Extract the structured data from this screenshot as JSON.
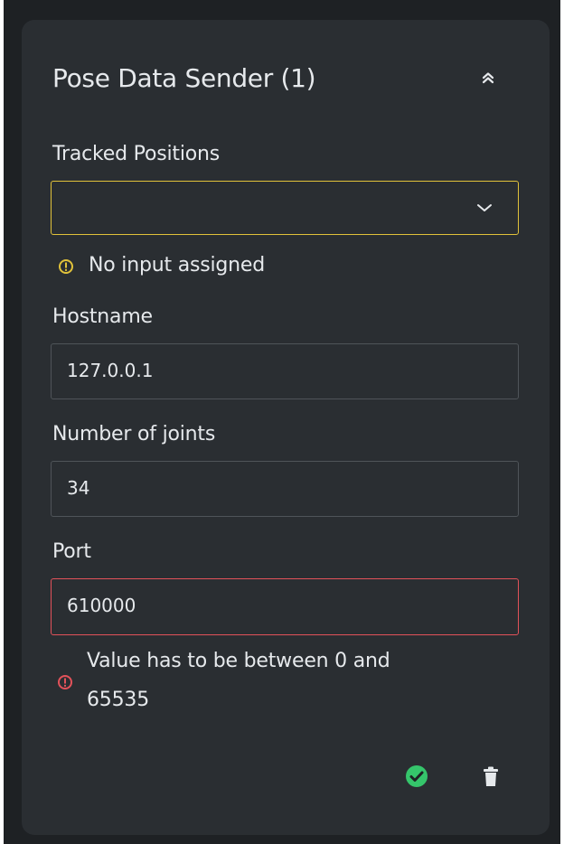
{
  "card": {
    "title": "Pose Data Sender (1)",
    "collapse_icon": "double-chevron-up-icon"
  },
  "tracked_positions": {
    "label": "Tracked Positions",
    "value": "",
    "dropdown_icon": "chevron-down-icon",
    "warning_icon": "warning-circle-icon",
    "warning_text": "No input assigned",
    "warning_color": "#e1c23a"
  },
  "hostname": {
    "label": "Hostname",
    "value": "127.0.0.1"
  },
  "joints": {
    "label": "Number of joints",
    "value": "34"
  },
  "port": {
    "label": "Port",
    "value": "610000",
    "error_icon": "error-circle-icon",
    "error_line1": "Value has to be between 0 and",
    "error_line2": "65535",
    "error_color": "#e2525a"
  },
  "actions": {
    "confirm_icon": "check-circle-icon",
    "confirm_color": "#35c56b",
    "delete_icon": "trash-icon"
  }
}
